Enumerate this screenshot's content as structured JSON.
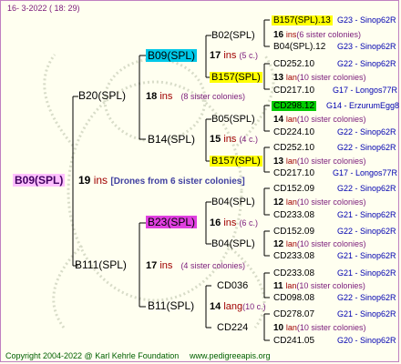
{
  "header": {
    "date": "16-  3-2022 ( 18: 29)"
  },
  "footer": {
    "copyright": "Copyright 2004-2022 @ Karl Kehrle Foundation",
    "url": "www.pedigreeapis.org"
  },
  "colors": {
    "cyan": "#00c8e8",
    "yellow": "#ffff00",
    "magenta": "#e040e0",
    "green": "#00cc00",
    "blue_text": "#0000b0",
    "line": "#000000"
  },
  "root": {
    "name": "B09(SPL)",
    "count": "19",
    "unit": "ins",
    "note": "[Drones from 6 sister colonies]"
  },
  "nodes": {
    "b20": {
      "name": "B20(SPL)",
      "count": "18",
      "unit": "ins",
      "note": "(8 sister colonies)"
    },
    "b111": {
      "name": "B111(SPL)",
      "count": "17",
      "unit": "ins",
      "note": "(4 sister colonies)"
    },
    "b09": {
      "name": "B09(SPL)",
      "count": "17",
      "unit": "ins",
      "note": "(5 c.)"
    },
    "b14": {
      "name": "B14(SPL)",
      "count": "15",
      "unit": "ins",
      "note": "(4 c.)"
    },
    "b23": {
      "name": "B23(SPL)",
      "count": "16",
      "unit": "ins",
      "note": "(6 c.)"
    },
    "b11": {
      "name": "B11(SPL)",
      "count": "14",
      "unit": "lang",
      "note": "(10 c.)"
    },
    "b02": {
      "name": "B02(SPL)"
    },
    "b157a": {
      "name": "B157(SPL)"
    },
    "b05": {
      "name": "B05(SPL)"
    },
    "b157b": {
      "name": "B157(SPL)"
    },
    "b04a": {
      "name": "B04(SPL)"
    },
    "b04b": {
      "name": "B04(SPL)"
    },
    "cd036": {
      "name": "CD036"
    },
    "cd224": {
      "name": "CD224"
    }
  },
  "leaves": [
    {
      "name": "B157(SPL).13",
      "label": "G23 - Sinop62R"
    },
    {
      "name": "16",
      "unit": "ins",
      "note": "(6 sister colonies)"
    },
    {
      "name": "B04(SPL).12",
      "label": "G23 - Sinop62R"
    },
    {
      "name": "CD252.10",
      "label": "G22 - Sinop62R"
    },
    {
      "name": "13",
      "unit": "lan",
      "note": "(10 sister colonies)"
    },
    {
      "name": "CD217.10",
      "label": "G17 - Longos77R"
    },
    {
      "name": "CD298.12",
      "label": "G14 - ErzurumEgg8"
    },
    {
      "name": "14",
      "unit": "lan",
      "note": "(10 sister colonies)"
    },
    {
      "name": "CD224.10",
      "label": "G22 - Sinop62R"
    },
    {
      "name": "CD252.10",
      "label": "G22 - Sinop62R"
    },
    {
      "name": "13",
      "unit": "lan",
      "note": "(10 sister colonies)"
    },
    {
      "name": "CD217.10",
      "label": "G17 - Longos77R"
    },
    {
      "name": "CD152.09",
      "label": "G22 - Sinop62R"
    },
    {
      "name": "12",
      "unit": "lan",
      "note": "(10 sister colonies)"
    },
    {
      "name": "CD233.08",
      "label": "G21 - Sinop62R"
    },
    {
      "name": "CD152.09",
      "label": "G22 - Sinop62R"
    },
    {
      "name": "12",
      "unit": "lan",
      "note": "(10 sister colonies)"
    },
    {
      "name": "CD233.08",
      "label": "G21 - Sinop62R"
    },
    {
      "name": "CD233.08",
      "label": "G21 - Sinop62R"
    },
    {
      "name": "11",
      "unit": "lan",
      "note": "(10 sister colonies)"
    },
    {
      "name": "CD098.08",
      "label": "G22 - Sinop62R"
    },
    {
      "name": "CD278.07",
      "label": "G21 - Sinop62R"
    },
    {
      "name": "10",
      "unit": "lan",
      "note": "(10 sister colonies)"
    },
    {
      "name": "CD241.05",
      "label": "G20 - Sinop62R"
    }
  ]
}
